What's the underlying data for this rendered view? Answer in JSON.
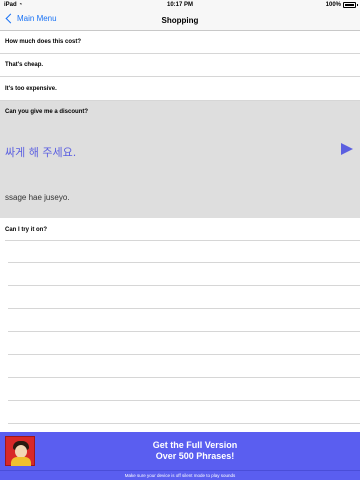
{
  "status_bar": {
    "carrier": "iPad",
    "time": "10:17 PM",
    "battery": "100%",
    "battery_level": 1.0
  },
  "nav": {
    "back_label": "Main Menu",
    "title": "Shopping"
  },
  "rows": [
    {
      "label": "How much does this cost?"
    },
    {
      "label": "That's cheap."
    },
    {
      "label": "It's too expensive."
    }
  ],
  "expanded": {
    "question": "Can you give me a discount?",
    "korean": "싸게 해 주세요.",
    "romanization": "ssage hae juseyo."
  },
  "after_row": {
    "label": "Can I try it on?"
  },
  "banner": {
    "line1": "Get the Full Version",
    "line2": "Over 500 Phrases!"
  },
  "footer_note": "Make sure your device is off silent mode to play sounds",
  "colors": {
    "accent": "#1a73f5",
    "korean_text": "#5b5fe0",
    "banner": "#5a5ef0"
  }
}
